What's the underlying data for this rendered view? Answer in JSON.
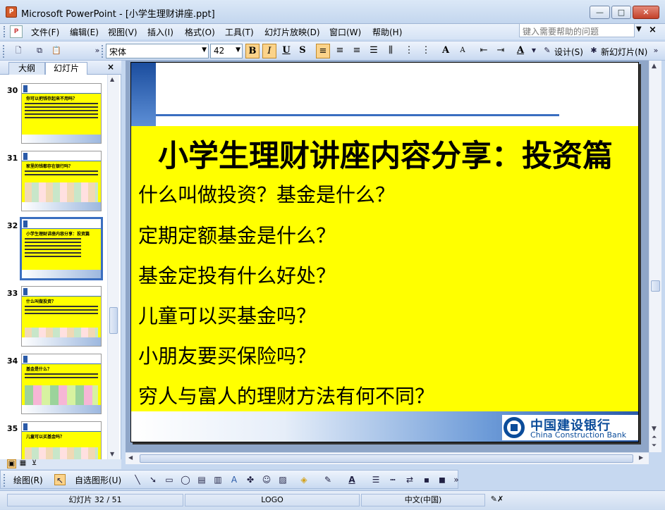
{
  "window": {
    "title": "Microsoft PowerPoint - [小学生理财讲座.ppt]",
    "app_icon": "powerpoint-icon",
    "min_glyph": "—",
    "max_glyph": "□",
    "close_glyph": "✕"
  },
  "menu": {
    "items": [
      "文件(F)",
      "编辑(E)",
      "视图(V)",
      "插入(I)",
      "格式(O)",
      "工具(T)",
      "幻灯片放映(D)",
      "窗口(W)",
      "帮助(H)"
    ],
    "help_placeholder": "键入需要帮助的问题",
    "close_glyph": "×"
  },
  "format_toolbar": {
    "font": "宋体",
    "size": "42",
    "bold": "B",
    "italic": "I",
    "underline": "U",
    "shadow": "S",
    "design_label": "设计(S)",
    "new_slide_label": "新幻灯片(N)"
  },
  "left_pane": {
    "tabs": [
      "大纲",
      "幻灯片"
    ],
    "close_glyph": "×",
    "thumbnails": [
      {
        "number": "30",
        "title": "你可以把钱存起来不用吗？"
      },
      {
        "number": "31",
        "title": "家里的钱都存在银行吗？"
      },
      {
        "number": "32",
        "title": "小学生理财讲座内容分享：投资篇"
      },
      {
        "number": "33",
        "title": "什么叫做投资？"
      },
      {
        "number": "34",
        "title": "基金是什么？"
      },
      {
        "number": "35",
        "title": "儿童可以买基金吗？"
      }
    ],
    "selected_index": 2
  },
  "slide": {
    "title": "小学生理财讲座内容分享：投资篇",
    "lines": [
      "什么叫做投资？基金是什么？",
      "定期定额基金是什么？",
      "基金定投有什么好处？",
      "儿童可以买基金吗？",
      "小朋友要买保险吗？",
      "穷人与富人的理财方法有何不同？"
    ],
    "logo_cn": "中国建设银行",
    "logo_en": "China Construction Bank",
    "colors": {
      "yellow": "#FFFF00",
      "brand_blue": "#0B4C9A"
    }
  },
  "draw_toolbar": {
    "draw_label": "绘图(R)",
    "autoshapes_label": "自选图形(U)"
  },
  "status": {
    "slide_info": "幻灯片 32 / 51",
    "design": "LOGO",
    "language": "中文(中国)"
  }
}
